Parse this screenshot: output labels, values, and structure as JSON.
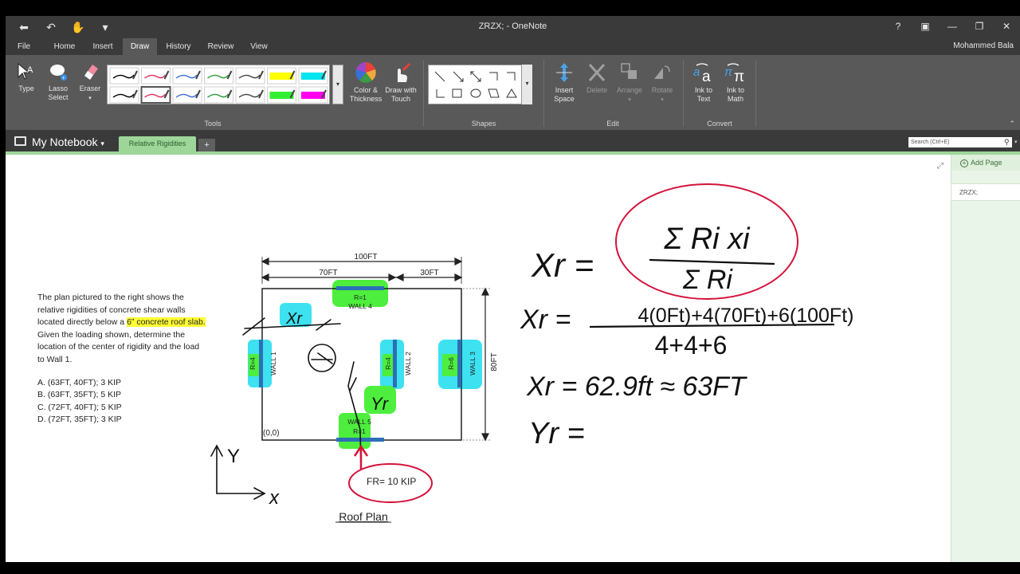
{
  "window": {
    "title": "ZRZX; - OneNote",
    "user": "Mohammed Bala",
    "qat_icons": [
      "back-icon",
      "undo-icon",
      "touch-mode-icon",
      "customize-icon"
    ]
  },
  "tabs": [
    "File",
    "Home",
    "Insert",
    "Draw",
    "History",
    "Review",
    "View"
  ],
  "active_tab": "Draw",
  "ribbon": {
    "tools": {
      "label": "Tools",
      "type": "Type",
      "lasso_line1": "Lasso",
      "lasso_line2": "Select",
      "eraser": "Eraser",
      "color_line1": "Color &",
      "color_line2": "Thickness",
      "drawtouch_line1": "Draw with",
      "drawtouch_line2": "Touch"
    },
    "pen_colors": [
      "#000000",
      "#e0305a",
      "#3a6fd8",
      "#2e9a3a",
      "#444444",
      "#ffff00",
      "#00e5ee",
      "#000000",
      "#e0305a",
      "#3a6fd8",
      "#2e9a3a",
      "#444444",
      "#33ee33",
      "#ff00ee"
    ],
    "shapes": {
      "label": "Shapes"
    },
    "edit": {
      "label": "Edit",
      "insert_space_line1": "Insert",
      "insert_space_line2": "Space",
      "delete": "Delete",
      "arrange": "Arrange",
      "rotate": "Rotate"
    },
    "convert": {
      "label": "Convert",
      "ink_text_line1": "Ink to",
      "ink_text_line2": "Text",
      "ink_math_line1": "Ink to",
      "ink_math_line2": "Math"
    }
  },
  "notebook": {
    "name": "My Notebook",
    "section": "Relative Rigidities",
    "add_section": "+",
    "search_placeholder": "Search (Ctrl+E)"
  },
  "pages": {
    "add_page": "Add Page",
    "items": [
      "ZRZX;"
    ]
  },
  "question": {
    "line1": "The plan pictured to the right shows the",
    "line2": "relative rigidities of concrete shear walls",
    "line3a": "located directly below a ",
    "line3_highlight": "6” concrete roof slab.",
    "line4": "Given the loading shown, determine the",
    "line5": "location of the center of rigidity and the load",
    "line6": "to Wall 1.",
    "choices": [
      "A. (63FT, 40FT); 3 KIP",
      "B. (63FT, 35FT); 5 KIP",
      "C. (72FT, 40FT); 5 KIP",
      "D. (72FT, 35FT); 3 KIP"
    ]
  },
  "plan": {
    "dim_total": "100FT",
    "dim_left": "70FT",
    "dim_right": "30FT",
    "dim_height": "80FT",
    "origin": "(0,0)",
    "caption": "Roof Plan",
    "force": "FR= 10 KIP",
    "walls": [
      {
        "name": "WALL 1",
        "rigidity": "R=4"
      },
      {
        "name": "WALL 2",
        "rigidity": "R=4"
      },
      {
        "name": "WALL 3",
        "rigidity": "R=6"
      },
      {
        "name": "WALL 4",
        "rigidity": "R=1"
      },
      {
        "name": "WALL 5",
        "rigidity": "R=1"
      }
    ],
    "axis_x": "x",
    "axis_y": "Y"
  },
  "ink": {
    "sketch_xr": "Xr",
    "sketch_yr": "Yr",
    "eq1_lhs": "Xr =",
    "eq1_num": "Σ Ri xi",
    "eq1_den": "Σ Ri",
    "eq2_lhs": "Xr =",
    "eq2_num": "4(0Ft)+4(70Ft)+6(100Ft)",
    "eq2_den": "4+4+6",
    "eq3": "Xr = 62.9ft ≈ 63FT",
    "eq4": "Yr ="
  }
}
